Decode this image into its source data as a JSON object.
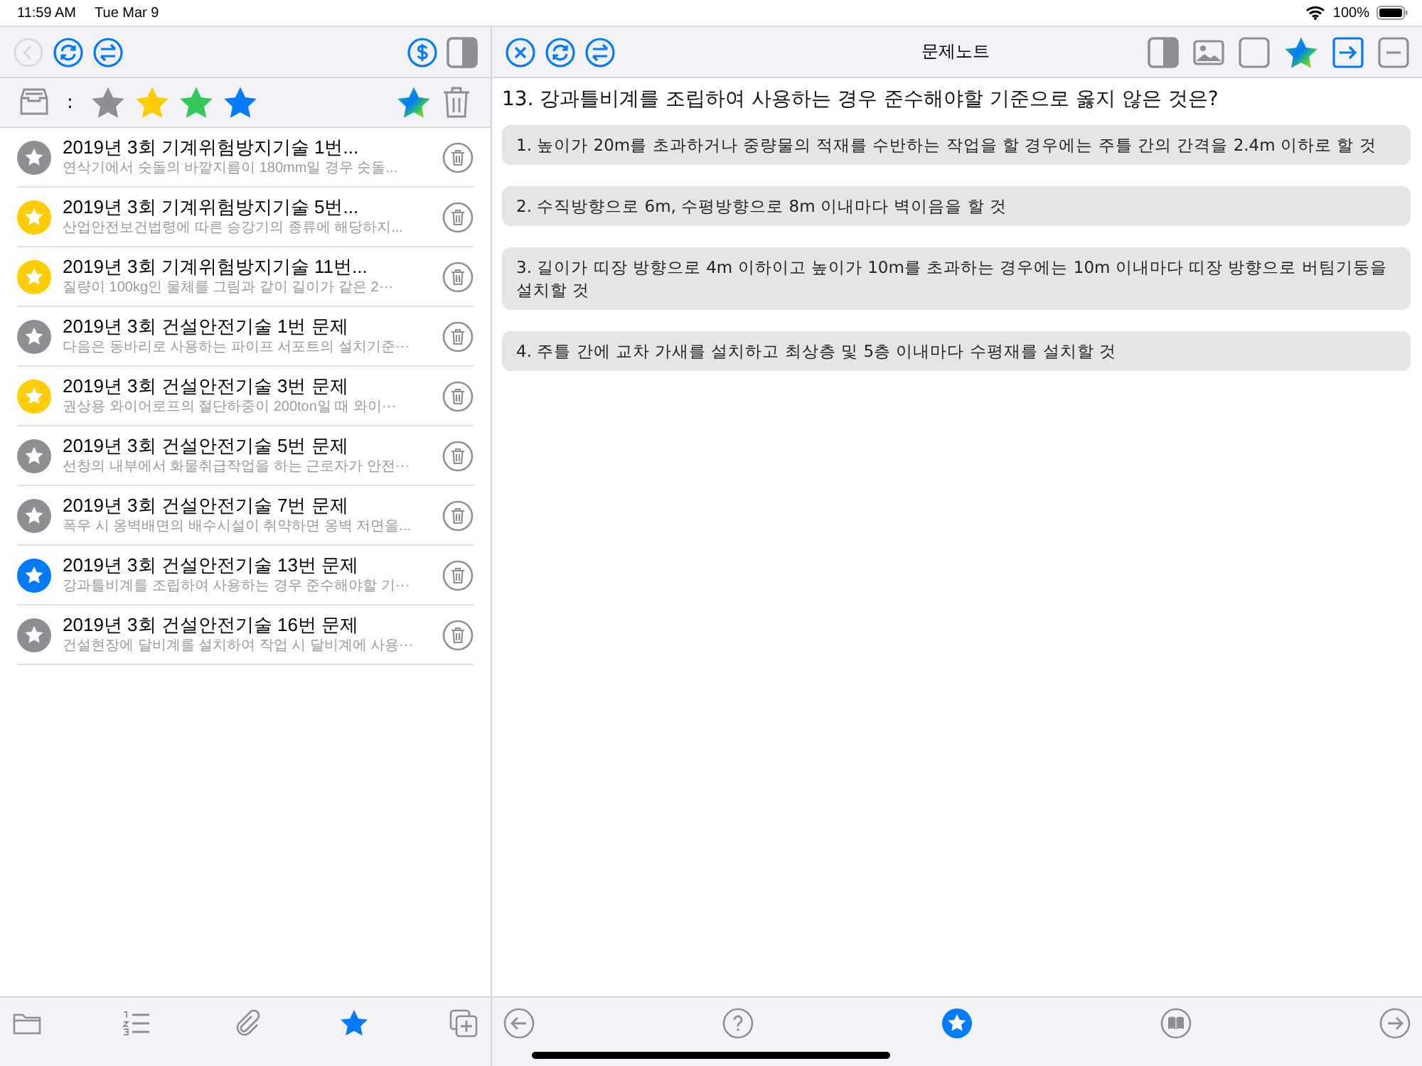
{
  "status_bar": {
    "time": "11:59 AM",
    "date": "Tue Mar 9",
    "battery": "100%"
  },
  "left_toolbar": {
    "back_button": {
      "disabled": true
    }
  },
  "filter": {
    "separator": ":",
    "stars": [
      {
        "color": "#8e8e93"
      },
      {
        "color": "#ffcc00"
      },
      {
        "color": "#34c759"
      },
      {
        "color": "#007aff"
      }
    ]
  },
  "notes": [
    {
      "title": "2019년 3회 기계위험방지기술 1번...",
      "preview": "연삭기에서 숫돌의 바깥지름이 180mm일 경우 숫돌...",
      "color": "#8e8e93"
    },
    {
      "title": "2019년 3회 기계위험방지기술 5번...",
      "preview": "산업안전보건법령에 따른 승강기의 종류에 해당하지...",
      "color": "#ffcc00"
    },
    {
      "title": "2019년 3회 기계위험방지기술 11번...",
      "preview": "질량이 100kg인 물체를 그림과 같이 길이가 같은 2⋯",
      "color": "#ffcc00"
    },
    {
      "title": "2019년 3회 건설안전기술 1번 문제",
      "preview": "다음은 동바리로 사용하는 파이프 서포트의 설치기준⋯",
      "color": "#8e8e93"
    },
    {
      "title": "2019년 3회 건설안전기술 3번 문제",
      "preview": "권상용 와이어로프의 절단하중이 200ton일 때 와이⋯",
      "color": "#ffcc00"
    },
    {
      "title": "2019년 3회 건설안전기술 5번 문제",
      "preview": "선창의 내부에서 화물취급작업을 하는 근로자가 안전⋯",
      "color": "#8e8e93"
    },
    {
      "title": "2019년 3회 건설안전기술 7번 문제",
      "preview": "폭우 시 옹벽배면의 배수시설이 취약하면 옹벽 저면을...",
      "color": "#8e8e93"
    },
    {
      "title": "2019년 3회 건설안전기술 13번 문제",
      "preview": "강과틀비계를 조립하여 사용하는 경우 준수해야할 기⋯",
      "color": "#007aff"
    },
    {
      "title": "2019년 3회 건설안전기술 16번 문제",
      "preview": "건설현장에 달비계를 설치하여 작업 시 달비계에 사용⋯",
      "color": "#8e8e93"
    }
  ],
  "left_tab_bar": [
    {
      "selected": false
    },
    {
      "selected": false
    },
    {
      "selected": false
    },
    {
      "selected": true
    },
    {
      "selected": false
    }
  ],
  "right_toolbar": {
    "title": "문제노트"
  },
  "question": "13. 강과틀비계를 조립하여 사용하는 경우 준수해야할 기준으로 옳지 않은 것은?",
  "options": [
    "1. 높이가 20m를 초과하거나 중량물의 적재를 수반하는 작업을 할 경우에는 주틀 간의 간격을 2.4m 이하로 할 것",
    "2. 수직방향으로 6m, 수평방향으로 8m 이내마다 벽이음을 할 것",
    "3. 길이가 띠장 방향으로 4m 이하이고 높이가 10m를 초과하는 경우에는 10m 이내마다 띠장 방향으로 버팀기둥을 설치할 것",
    "4. 주틀 간에 교차 가새를 설치하고 최상층 및 5층 이내마다 수평재를 설치할 것"
  ],
  "right_tab_bar": [
    {
      "selected": false
    },
    {
      "selected": false
    },
    {
      "selected": true
    },
    {
      "selected": false
    },
    {
      "selected": false
    }
  ]
}
